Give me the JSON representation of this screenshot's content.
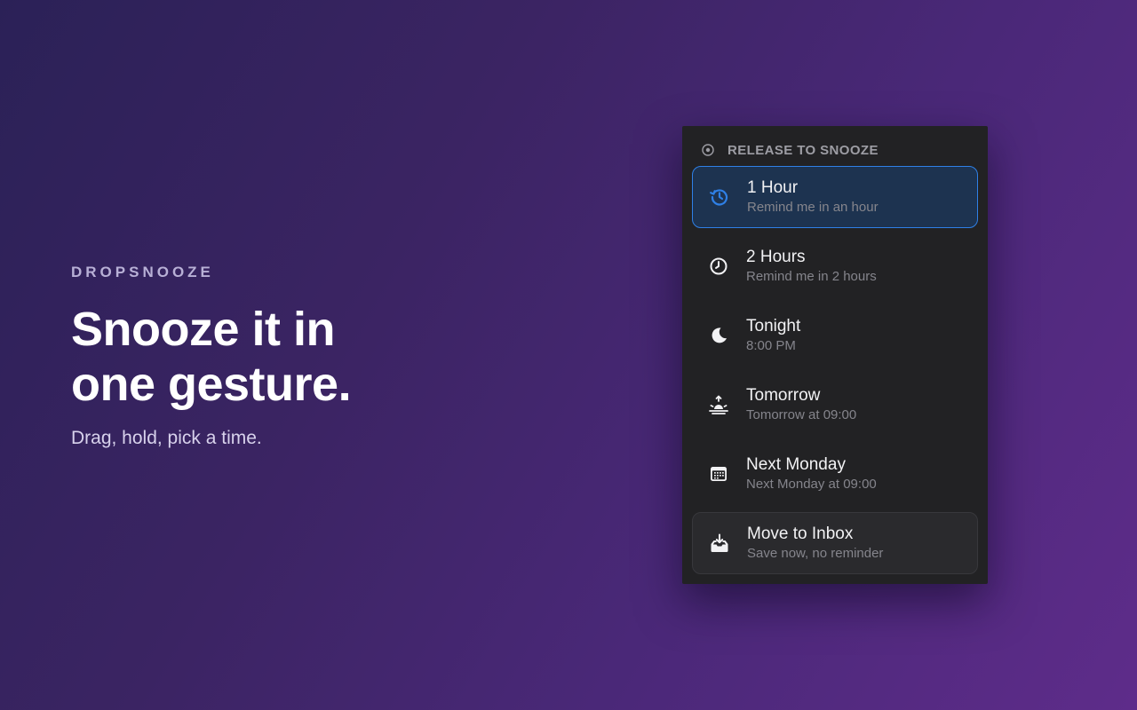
{
  "hero": {
    "brand": "DROPSNOOZE",
    "headline_line1": "Snooze it in",
    "headline_line2": "one gesture.",
    "tagline": "Drag, hold, pick a time."
  },
  "menu": {
    "header": "RELEASE TO SNOOZE",
    "header_icon": "target-circle-icon",
    "items": [
      {
        "title": "1 Hour",
        "subtitle": "Remind me in an hour",
        "icon": "clock-history-icon",
        "selected": true
      },
      {
        "title": "2 Hours",
        "subtitle": "Remind me in 2 hours",
        "icon": "clock-icon",
        "selected": false
      },
      {
        "title": "Tonight",
        "subtitle": "8:00 PM",
        "icon": "moon-icon",
        "selected": false
      },
      {
        "title": "Tomorrow",
        "subtitle": "Tomorrow at 09:00",
        "icon": "sunrise-icon",
        "selected": false
      },
      {
        "title": "Next Monday",
        "subtitle": "Next Monday at 09:00",
        "icon": "calendar-icon",
        "selected": false
      },
      {
        "title": "Move to Inbox",
        "subtitle": "Save now, no reminder",
        "icon": "inbox-download-icon",
        "selected": false
      }
    ]
  },
  "colors": {
    "accent": "#2f80e6",
    "selected_bg": "#1d3350",
    "menu_bg": "#222224",
    "background_start": "#2b2157",
    "background_end": "#5e2c8a"
  }
}
